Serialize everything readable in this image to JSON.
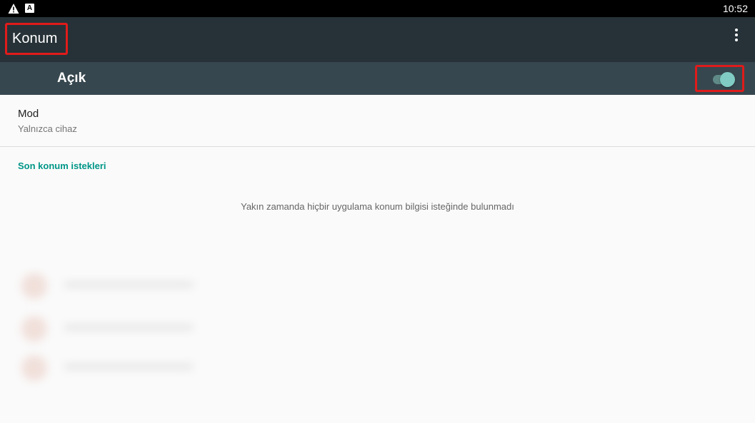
{
  "status_bar": {
    "time": "10:52",
    "left_icons": [
      "warning-icon",
      "a-notification-icon"
    ]
  },
  "app_bar": {
    "title": "Konum",
    "menu_icon": "overflow-menu-icon"
  },
  "master_switch": {
    "label": "Açık",
    "state": "on",
    "colors": {
      "track": "#5f8a87",
      "thumb": "#80cbc4"
    }
  },
  "mode_preference": {
    "title": "Mod",
    "summary": "Yalnızca cihaz"
  },
  "recent_requests": {
    "header": "Son konum istekleri",
    "empty_message": "Yakın zamanda hiçbir uygulama konum bilgisi isteğinde bulunmadı"
  },
  "colors": {
    "app_bar": "#263238",
    "switch_bar": "#37474f",
    "accent": "#009688",
    "highlight_box": "#e01b1b"
  }
}
